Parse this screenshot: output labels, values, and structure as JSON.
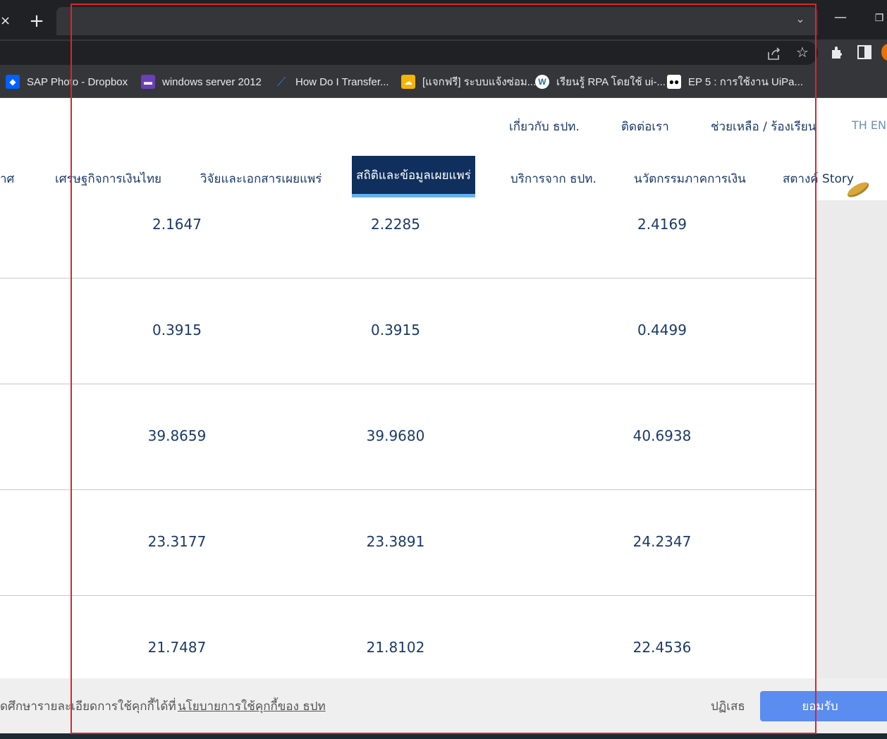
{
  "browser": {
    "tab_close": "×",
    "tab_new": "+",
    "tab_search": "⌄",
    "window_min": "—",
    "window_max": "❐"
  },
  "bookmarks": [
    {
      "label": "SAP Photo - Dropbox",
      "icon": "dropbox-icon",
      "color": "#0061fe"
    },
    {
      "label": "windows server 2012",
      "icon": "visual-studio-icon",
      "color": "#6b3fb6"
    },
    {
      "label": "How Do I Transfer...",
      "icon": "transfer-icon",
      "color": "#2a7bd8"
    },
    {
      "label": "[แจกฟรี] ระบบแจ้งซ่อม...",
      "icon": "cloud-icon",
      "color": "#f4b400"
    },
    {
      "label": "เรียนรู้ RPA โดยใช้ ui-...",
      "icon": "wordpress-icon",
      "color": "#ffffff"
    },
    {
      "label": "EP 5 : การใช้งาน UiPa...",
      "icon": "medium-icon",
      "color": "#ffffff"
    }
  ],
  "top_nav": {
    "about": "เกี่ยวกับ ธปท.",
    "contact": "ติดต่อเรา",
    "help": "ช่วยเหลือ / ร้องเรียน",
    "lang": "TH EN"
  },
  "main_nav": {
    "items": [
      "าศ",
      "เศรษฐกิจการเงินไทย",
      "วิจัยและเอกสารเผยแพร่",
      "สถิติและข้อมูลเผยแพร่",
      "บริการจาก ธปท.",
      "นวัตกรรมภาคการเงิน",
      "สตางค์ Story"
    ],
    "active_index": 3
  },
  "table": {
    "rows": [
      [
        "2.1647",
        "2.2285",
        "2.4169"
      ],
      [
        "0.3915",
        "0.3915",
        "0.4499"
      ],
      [
        "39.8659",
        "39.9680",
        "40.6938"
      ],
      [
        "23.3177",
        "23.3891",
        "24.2347"
      ],
      [
        "21.7487",
        "21.8102",
        "22.4536"
      ]
    ]
  },
  "cookie": {
    "text": "ดศึกษารายละเอียดการใช้คุกกี้ได้ที่",
    "link": "นโยบายการใช้คุกกี้ของ ธปท",
    "reject": "ปฏิเสธ",
    "accept": "ยอมรับ"
  }
}
